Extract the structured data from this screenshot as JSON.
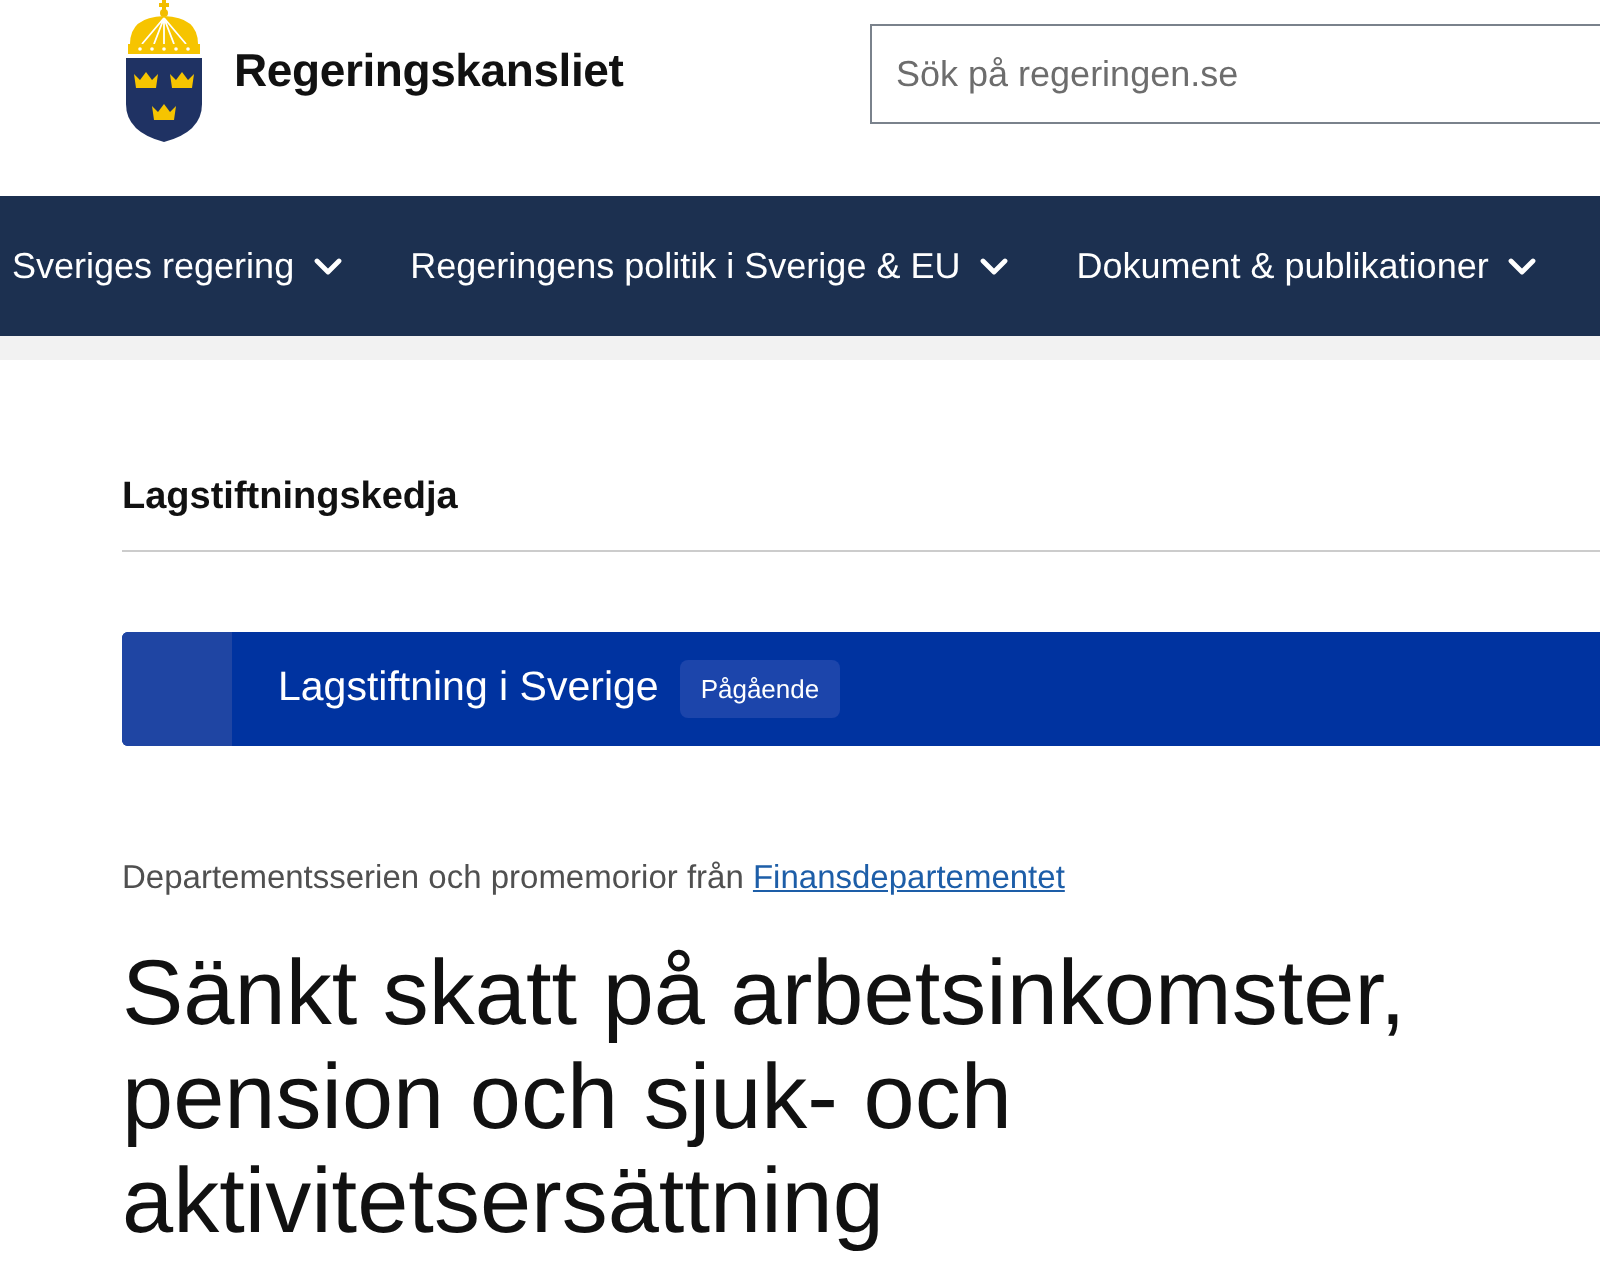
{
  "header": {
    "logo": {
      "text": "Regeringskansliet"
    },
    "search": {
      "placeholder": "Sök på regeringen.se"
    }
  },
  "navigation": {
    "items": [
      {
        "label": "Sveriges regering"
      },
      {
        "label": "Regeringens politik i Sverige & EU"
      },
      {
        "label": "Dokument & publikationer"
      }
    ]
  },
  "section_heading": "Lagstiftningskedja",
  "banner": {
    "title": "Lagstiftning i Sverige",
    "status": "Pågående"
  },
  "series": {
    "text": "Departementsserien och promemorior från",
    "link": "Finansdepartementet"
  },
  "title": "Sänkt skatt på arbetsinkomster, pension och sjuk- och aktivitetsersättning"
}
